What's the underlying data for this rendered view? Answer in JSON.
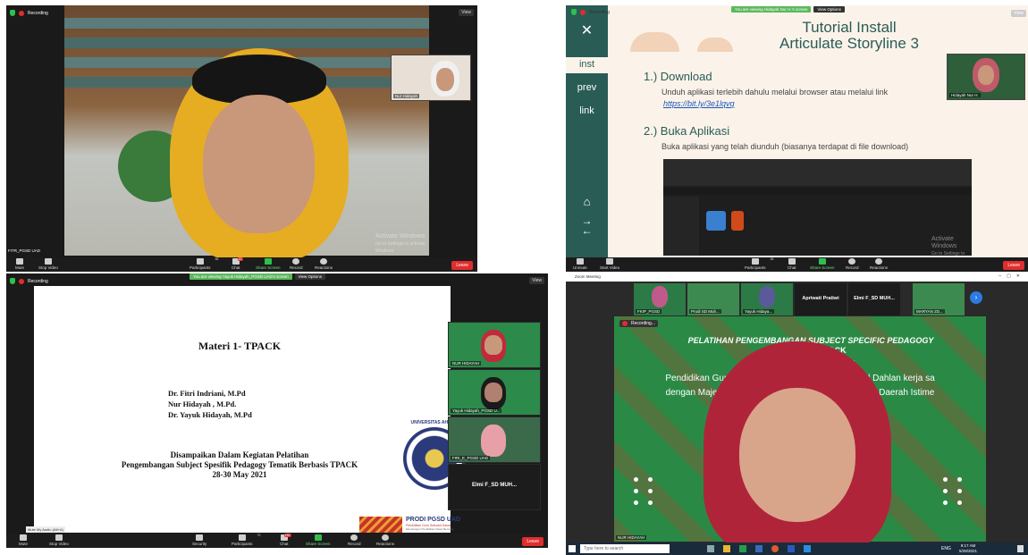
{
  "q1": {
    "recording": "Recording",
    "view": "View",
    "self_tile_name": "Nur Hidayah",
    "speaker_name": "FITR_PGSD UAD",
    "watermark_title": "Activate Windows",
    "watermark_sub": "Go to Settings to activate Windows.",
    "toolbar": {
      "mute": "Mute",
      "stop_video": "Stop Video",
      "participants": "Participants",
      "participants_count": "66",
      "chat": "Chat",
      "chat_badge": "12",
      "share_screen": "Share Screen",
      "record": "Record",
      "reactions": "Reactions",
      "leave": "Leave"
    }
  },
  "q2": {
    "recording": "Recording",
    "share_banner": "You are viewing Hidayah Nur H.'s screen",
    "view_options": "View Options",
    "view": "View",
    "sidebar": {
      "close": "✕",
      "item1": "inst",
      "item2": "prev",
      "item3": "link"
    },
    "title_line1": "Tutorial Install",
    "title_line2": "Articulate Storyline 3",
    "step1_heading": "1.) Download",
    "step1_text": "Unduh aplikasi terlebih dahulu melalui browser atau melalui link",
    "step1_link": "https://bit.ly/3e1lqvq",
    "step2_heading": "2.) Buka Aplikasi",
    "step2_text": "Buka aplikasi yang telah diunduh (biasanya terdapat di file download)",
    "thumb_name": "Hidayah Nur H.",
    "watermark_title": "Activate Windows",
    "watermark_sub": "Go to Settings to activate Windows.",
    "toolbar": {
      "unmute": "Unmute",
      "start_video": "Start Video",
      "participants": "Participants",
      "participants_count": "66",
      "chat": "Chat",
      "share_screen": "Share Screen",
      "record": "Record",
      "reactions": "Reactions",
      "leave": "Leave"
    }
  },
  "q3": {
    "recording": "Recording",
    "share_banner": "You are viewing Yayuk Hidayah_PGSD UAD's screen",
    "view_options": "View Options",
    "view": "View",
    "slide_title": "Materi 1- TPACK",
    "author1": "Dr. Fitri Indriani, M.Pd",
    "author2": "Nur Hidayah , M.Pd.",
    "author3": "Dr. Yayuk Hidayah, M.Pd",
    "event_line1": "Disampaikan Dalam Kegiatan Pelatihan",
    "event_line2": "Pengembangan Subject Spesifik Pedagogy Tematik Berbasis TPACK",
    "event_line3": "28-30 May 2021",
    "seal_text": "UNIVERSITAS AHMAD",
    "brand_name": "PRODI PGSD UAD",
    "brand_sub": "Pendidikan Guru Sekolah Dasar",
    "brand_tag": "Membangun Pendidikan Dasar Bermutu",
    "tiles": [
      "NUR HIDAYAH",
      "Yayuk Hidayah_PGSD U...",
      "FIRI_E_PGSD UAD"
    ],
    "name_tile": "Elmi F_SD MUH...",
    "mute_tooltip": "Mute My Audio (Alt+A)",
    "toolbar": {
      "mute": "Mute",
      "stop_video": "Stop Video",
      "security": "Security",
      "participants": "Participants",
      "participants_count": "70",
      "chat": "Chat",
      "chat_badge": "151",
      "share_screen": "Share Screen",
      "record": "Record",
      "reactions": "Reactions",
      "leave": "Leave"
    }
  },
  "q4": {
    "window_title": "Zoom Meeting",
    "strip_names": [
      "FKIP_PGSD",
      "Prodi SD Muh...",
      "Yayuk Hidaya...",
      "Apriwati Pratiwi",
      "Elmi F_SD MUH...",
      "MARYAN 2D..."
    ],
    "recording": "Recording...",
    "slide_line1": "PELATIHAN PENGEMBANGAN SUBJECT SPECIFIC PEDAGOGY",
    "slide_line2": "BERBASIS TPACK",
    "slide_line3": "Diselenggarakan oleh:",
    "slide_line4": "Pendidikan Guru Sekolah Dasar Universitas Ahmad Dahlan kerja sa",
    "slide_line5": "dengan Majelis Dikdasmen PDM Kabupaten Sleman, Daerah Istime",
    "speaker_name": "NUR HIDAYAH",
    "taskbar": {
      "search": "Type here to search",
      "lang": "ENG",
      "time": "9:17 AM",
      "date": "5/28/2021"
    }
  }
}
